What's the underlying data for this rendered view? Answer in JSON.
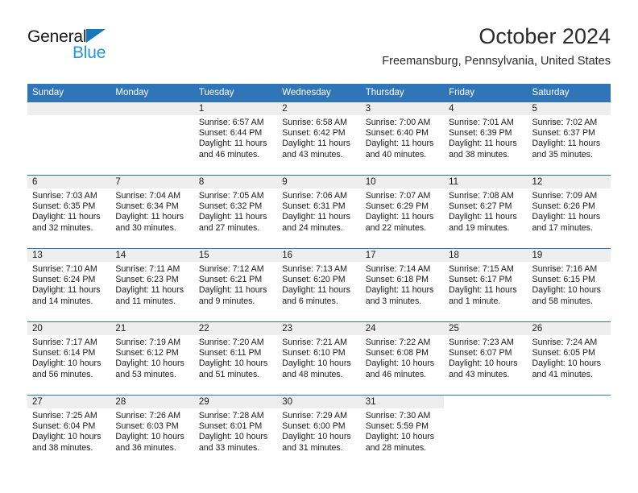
{
  "brand": {
    "name_top": "General",
    "name_bottom": "Blue",
    "accent_color": "#2196e3",
    "triangle_color": "#1878be"
  },
  "header": {
    "month_title": "October 2024",
    "location": "Freemansburg, Pennsylvania, United States"
  },
  "theme": {
    "header_row_color": "#3075b8",
    "daynum_band_color": "#eeeeee",
    "separator_color": "#3075b8"
  },
  "weekday_headers": [
    "Sunday",
    "Monday",
    "Tuesday",
    "Wednesday",
    "Thursday",
    "Friday",
    "Saturday"
  ],
  "labels": {
    "sunrise_prefix": "Sunrise:",
    "sunset_prefix": "Sunset:",
    "daylight_prefix": "Daylight:"
  },
  "weeks": [
    [
      {
        "day": "",
        "sunrise": "",
        "sunset": "",
        "daylight_line1": "",
        "daylight_line2": ""
      },
      {
        "day": "",
        "sunrise": "",
        "sunset": "",
        "daylight_line1": "",
        "daylight_line2": ""
      },
      {
        "day": "1",
        "sunrise": "Sunrise: 6:57 AM",
        "sunset": "Sunset: 6:44 PM",
        "daylight_line1": "Daylight: 11 hours",
        "daylight_line2": "and 46 minutes."
      },
      {
        "day": "2",
        "sunrise": "Sunrise: 6:58 AM",
        "sunset": "Sunset: 6:42 PM",
        "daylight_line1": "Daylight: 11 hours",
        "daylight_line2": "and 43 minutes."
      },
      {
        "day": "3",
        "sunrise": "Sunrise: 7:00 AM",
        "sunset": "Sunset: 6:40 PM",
        "daylight_line1": "Daylight: 11 hours",
        "daylight_line2": "and 40 minutes."
      },
      {
        "day": "4",
        "sunrise": "Sunrise: 7:01 AM",
        "sunset": "Sunset: 6:39 PM",
        "daylight_line1": "Daylight: 11 hours",
        "daylight_line2": "and 38 minutes."
      },
      {
        "day": "5",
        "sunrise": "Sunrise: 7:02 AM",
        "sunset": "Sunset: 6:37 PM",
        "daylight_line1": "Daylight: 11 hours",
        "daylight_line2": "and 35 minutes."
      }
    ],
    [
      {
        "day": "6",
        "sunrise": "Sunrise: 7:03 AM",
        "sunset": "Sunset: 6:35 PM",
        "daylight_line1": "Daylight: 11 hours",
        "daylight_line2": "and 32 minutes."
      },
      {
        "day": "7",
        "sunrise": "Sunrise: 7:04 AM",
        "sunset": "Sunset: 6:34 PM",
        "daylight_line1": "Daylight: 11 hours",
        "daylight_line2": "and 30 minutes."
      },
      {
        "day": "8",
        "sunrise": "Sunrise: 7:05 AM",
        "sunset": "Sunset: 6:32 PM",
        "daylight_line1": "Daylight: 11 hours",
        "daylight_line2": "and 27 minutes."
      },
      {
        "day": "9",
        "sunrise": "Sunrise: 7:06 AM",
        "sunset": "Sunset: 6:31 PM",
        "daylight_line1": "Daylight: 11 hours",
        "daylight_line2": "and 24 minutes."
      },
      {
        "day": "10",
        "sunrise": "Sunrise: 7:07 AM",
        "sunset": "Sunset: 6:29 PM",
        "daylight_line1": "Daylight: 11 hours",
        "daylight_line2": "and 22 minutes."
      },
      {
        "day": "11",
        "sunrise": "Sunrise: 7:08 AM",
        "sunset": "Sunset: 6:27 PM",
        "daylight_line1": "Daylight: 11 hours",
        "daylight_line2": "and 19 minutes."
      },
      {
        "day": "12",
        "sunrise": "Sunrise: 7:09 AM",
        "sunset": "Sunset: 6:26 PM",
        "daylight_line1": "Daylight: 11 hours",
        "daylight_line2": "and 17 minutes."
      }
    ],
    [
      {
        "day": "13",
        "sunrise": "Sunrise: 7:10 AM",
        "sunset": "Sunset: 6:24 PM",
        "daylight_line1": "Daylight: 11 hours",
        "daylight_line2": "and 14 minutes."
      },
      {
        "day": "14",
        "sunrise": "Sunrise: 7:11 AM",
        "sunset": "Sunset: 6:23 PM",
        "daylight_line1": "Daylight: 11 hours",
        "daylight_line2": "and 11 minutes."
      },
      {
        "day": "15",
        "sunrise": "Sunrise: 7:12 AM",
        "sunset": "Sunset: 6:21 PM",
        "daylight_line1": "Daylight: 11 hours",
        "daylight_line2": "and 9 minutes."
      },
      {
        "day": "16",
        "sunrise": "Sunrise: 7:13 AM",
        "sunset": "Sunset: 6:20 PM",
        "daylight_line1": "Daylight: 11 hours",
        "daylight_line2": "and 6 minutes."
      },
      {
        "day": "17",
        "sunrise": "Sunrise: 7:14 AM",
        "sunset": "Sunset: 6:18 PM",
        "daylight_line1": "Daylight: 11 hours",
        "daylight_line2": "and 3 minutes."
      },
      {
        "day": "18",
        "sunrise": "Sunrise: 7:15 AM",
        "sunset": "Sunset: 6:17 PM",
        "daylight_line1": "Daylight: 11 hours",
        "daylight_line2": "and 1 minute."
      },
      {
        "day": "19",
        "sunrise": "Sunrise: 7:16 AM",
        "sunset": "Sunset: 6:15 PM",
        "daylight_line1": "Daylight: 10 hours",
        "daylight_line2": "and 58 minutes."
      }
    ],
    [
      {
        "day": "20",
        "sunrise": "Sunrise: 7:17 AM",
        "sunset": "Sunset: 6:14 PM",
        "daylight_line1": "Daylight: 10 hours",
        "daylight_line2": "and 56 minutes."
      },
      {
        "day": "21",
        "sunrise": "Sunrise: 7:19 AM",
        "sunset": "Sunset: 6:12 PM",
        "daylight_line1": "Daylight: 10 hours",
        "daylight_line2": "and 53 minutes."
      },
      {
        "day": "22",
        "sunrise": "Sunrise: 7:20 AM",
        "sunset": "Sunset: 6:11 PM",
        "daylight_line1": "Daylight: 10 hours",
        "daylight_line2": "and 51 minutes."
      },
      {
        "day": "23",
        "sunrise": "Sunrise: 7:21 AM",
        "sunset": "Sunset: 6:10 PM",
        "daylight_line1": "Daylight: 10 hours",
        "daylight_line2": "and 48 minutes."
      },
      {
        "day": "24",
        "sunrise": "Sunrise: 7:22 AM",
        "sunset": "Sunset: 6:08 PM",
        "daylight_line1": "Daylight: 10 hours",
        "daylight_line2": "and 46 minutes."
      },
      {
        "day": "25",
        "sunrise": "Sunrise: 7:23 AM",
        "sunset": "Sunset: 6:07 PM",
        "daylight_line1": "Daylight: 10 hours",
        "daylight_line2": "and 43 minutes."
      },
      {
        "day": "26",
        "sunrise": "Sunrise: 7:24 AM",
        "sunset": "Sunset: 6:05 PM",
        "daylight_line1": "Daylight: 10 hours",
        "daylight_line2": "and 41 minutes."
      }
    ],
    [
      {
        "day": "27",
        "sunrise": "Sunrise: 7:25 AM",
        "sunset": "Sunset: 6:04 PM",
        "daylight_line1": "Daylight: 10 hours",
        "daylight_line2": "and 38 minutes."
      },
      {
        "day": "28",
        "sunrise": "Sunrise: 7:26 AM",
        "sunset": "Sunset: 6:03 PM",
        "daylight_line1": "Daylight: 10 hours",
        "daylight_line2": "and 36 minutes."
      },
      {
        "day": "29",
        "sunrise": "Sunrise: 7:28 AM",
        "sunset": "Sunset: 6:01 PM",
        "daylight_line1": "Daylight: 10 hours",
        "daylight_line2": "and 33 minutes."
      },
      {
        "day": "30",
        "sunrise": "Sunrise: 7:29 AM",
        "sunset": "Sunset: 6:00 PM",
        "daylight_line1": "Daylight: 10 hours",
        "daylight_line2": "and 31 minutes."
      },
      {
        "day": "31",
        "sunrise": "Sunrise: 7:30 AM",
        "sunset": "Sunset: 5:59 PM",
        "daylight_line1": "Daylight: 10 hours",
        "daylight_line2": "and 28 minutes."
      },
      {
        "day": "",
        "sunrise": "",
        "sunset": "",
        "daylight_line1": "",
        "daylight_line2": ""
      },
      {
        "day": "",
        "sunrise": "",
        "sunset": "",
        "daylight_line1": "",
        "daylight_line2": ""
      }
    ]
  ]
}
